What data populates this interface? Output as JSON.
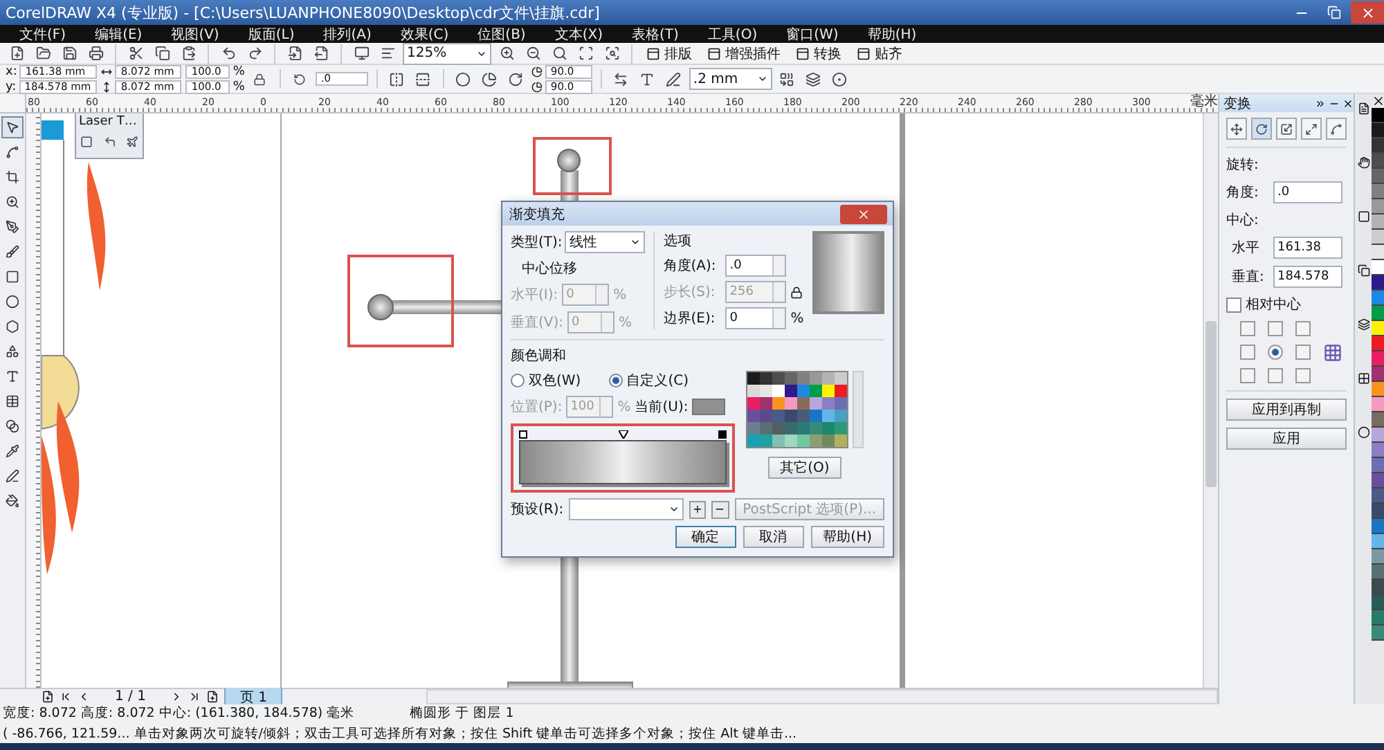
{
  "window": {
    "title": "CorelDRAW X4 (专业版) - [C:\\Users\\LUANPHONE8090\\Desktop\\cdr文件\\挂旗.cdr]"
  },
  "menu": [
    "文件(F)",
    "编辑(E)",
    "视图(V)",
    "版面(L)",
    "排列(A)",
    "效果(C)",
    "位图(B)",
    "文本(X)",
    "表格(T)",
    "工具(O)",
    "窗口(W)",
    "帮助(H)"
  ],
  "toolbar": {
    "zoom": "125%",
    "plugins": [
      "排版",
      "增强插件",
      "转换",
      "贴齐"
    ]
  },
  "property_bar": {
    "x": {
      "label": "x:",
      "value": "161.38 mm"
    },
    "y": {
      "label": "y:",
      "value": "184.578 mm"
    },
    "width": "8.072 mm",
    "height": "8.072 mm",
    "scale": [
      {
        "value": "100.0",
        "unit": "%"
      },
      {
        "value": "100.0",
        "unit": "%"
      }
    ],
    "rotation": ".0",
    "arc_angles": [
      "90.0",
      "90.0"
    ],
    "outline": ".2 mm"
  },
  "ruler": {
    "labels": [
      "80",
      "60",
      "40",
      "20",
      "0",
      "20",
      "40",
      "60",
      "80",
      "100",
      "120",
      "140",
      "160",
      "180",
      "200",
      "220",
      "240",
      "260",
      "280",
      "300"
    ],
    "unit": "毫米"
  },
  "toolbox": [
    {
      "selected": true
    },
    {
      "selected": false
    },
    {
      "selected": false
    },
    {
      "selected": false
    },
    {
      "selected": false
    },
    {
      "selected": false
    },
    {
      "selected": false
    },
    {
      "selected": false
    },
    {
      "selected": false
    },
    {
      "selected": false
    },
    {
      "selected": false
    },
    {
      "selected": false
    },
    {
      "selected": false
    },
    {
      "selected": false
    },
    {
      "selected": false
    },
    {
      "selected": false
    }
  ],
  "laser_toolbar": {
    "title": "Laser T…"
  },
  "dialog": {
    "title": "渐变填充",
    "type_label": "类型(T):",
    "type_value": "线性",
    "center_offset": "中心位移",
    "offsets": [
      {
        "label": "水平(I):",
        "value": "0",
        "unit": "%"
      },
      {
        "label": "垂直(V):",
        "value": "0",
        "unit": "%"
      }
    ],
    "options_title": "选项",
    "options": [
      {
        "label": "角度(A):",
        "value": ".0",
        "disabled": false
      },
      {
        "label": "步长(S):",
        "value": "256",
        "disabled": true
      },
      {
        "label": "边界(E):",
        "value": "0",
        "unit": "%",
        "disabled": false
      }
    ],
    "blend_title": "颜色调和",
    "radios": [
      {
        "label": "双色(W)",
        "selected": false
      },
      {
        "label": "自定义(C)",
        "selected": true
      }
    ],
    "position_label": "位置(P):",
    "position_value": "100",
    "position_unit": "%",
    "current_label": "当前(U):",
    "swatches": [
      {
        "color": "#1a1a1a"
      },
      {
        "color": "#333333"
      },
      {
        "color": "#4d4d4d"
      },
      {
        "color": "#666666"
      },
      {
        "color": "#808080"
      },
      {
        "color": "#999999"
      },
      {
        "color": "#b3b3b3"
      },
      {
        "color": "#cccccc"
      },
      {
        "color": "#d9d9d9"
      },
      {
        "color": "#e6e6e6"
      },
      {
        "color": "#ffffff"
      },
      {
        "color": "#2e1a8a"
      },
      {
        "color": "#1e88e5"
      },
      {
        "color": "#009e49"
      },
      {
        "color": "#fff200"
      },
      {
        "color": "#ed1c24"
      },
      {
        "color": "#e91e63"
      },
      {
        "color": "#a0306e"
      },
      {
        "color": "#f7941d"
      },
      {
        "color": "#f49ac1"
      },
      {
        "color": "#8c6a5a"
      },
      {
        "color": "#b7a6d9"
      },
      {
        "color": "#8a7fc4"
      },
      {
        "color": "#6a6fb5"
      },
      {
        "color": "#6b4f9e"
      },
      {
        "color": "#5a4a8a"
      },
      {
        "color": "#4a5a8a"
      },
      {
        "color": "#3a4a6a"
      },
      {
        "color": "#4a5a7a"
      },
      {
        "color": "#1a75c4"
      },
      {
        "color": "#62b6e8"
      },
      {
        "color": "#4aa0c0"
      },
      {
        "color": "#6a8090"
      },
      {
        "color": "#5a7070"
      },
      {
        "color": "#506060"
      },
      {
        "color": "#3a6a6a"
      },
      {
        "color": "#2a7a7a"
      },
      {
        "color": "#3a8a7a"
      },
      {
        "color": "#1a8a6a"
      },
      {
        "color": "#2a9a7a"
      },
      {
        "color": "#1aa0b0"
      },
      {
        "color": "#20a0a0"
      },
      {
        "color": "#80c0b0"
      },
      {
        "color": "#a0d8c0"
      },
      {
        "color": "#70c8a0"
      },
      {
        "color": "#8aa070"
      },
      {
        "color": "#708a60"
      },
      {
        "color": "#b0b060"
      }
    ],
    "other_button": "其它(O)",
    "preset_label": "预设(R):",
    "postscript_button": "PostScript 选项(P)...",
    "buttons": [
      "确定",
      "取消",
      "帮助(H)"
    ]
  },
  "docker": {
    "title": "变换",
    "tabs": [
      {
        "selected": false
      },
      {
        "selected": true
      },
      {
        "selected": false
      },
      {
        "selected": false
      },
      {
        "selected": false
      }
    ],
    "rotate_label": "旋转:",
    "angle_label": "角度:",
    "angle_value": ".0",
    "center_label": "中心:",
    "center_fields": [
      {
        "label": "水平",
        "value": "161.38"
      },
      {
        "label": "垂直:",
        "value": "184.578"
      }
    ],
    "relative_center": {
      "label": "相对中心",
      "checked": false
    },
    "anchors": [
      {
        "selected": false
      },
      {
        "selected": false
      },
      {
        "selected": false
      },
      {
        "selected": false
      },
      {
        "selected": true
      },
      {
        "selected": false
      },
      {
        "selected": false
      },
      {
        "selected": false
      },
      {
        "selected": false
      }
    ],
    "buttons": [
      "应用到再制",
      "应用"
    ]
  },
  "palette": [
    {
      "color": "#000000"
    },
    {
      "color": "#1a1a1a"
    },
    {
      "color": "#333333"
    },
    {
      "color": "#4d4d4d"
    },
    {
      "color": "#666666"
    },
    {
      "color": "#808080"
    },
    {
      "color": "#999999"
    },
    {
      "color": "#b3b3b3"
    },
    {
      "color": "#cccccc"
    },
    {
      "color": "#e6e6e6"
    },
    {
      "color": "#ffffff"
    },
    {
      "color": "#2e1a8a"
    },
    {
      "color": "#1e88e5"
    },
    {
      "color": "#009e49"
    },
    {
      "color": "#fff200"
    },
    {
      "color": "#ed1c24"
    },
    {
      "color": "#e91e63"
    },
    {
      "color": "#a0306e"
    },
    {
      "color": "#f7941d"
    },
    {
      "color": "#f49ac1"
    },
    {
      "color": "#7a6a60"
    },
    {
      "color": "#b7a6d9"
    },
    {
      "color": "#8a7fc4"
    },
    {
      "color": "#6a6fb5"
    },
    {
      "color": "#6b4f9e"
    },
    {
      "color": "#4a5a8a"
    },
    {
      "color": "#3a4a6a"
    },
    {
      "color": "#1a75c4"
    },
    {
      "color": "#62b6e8"
    },
    {
      "color": "#7a9aa8"
    },
    {
      "color": "#5a7070"
    },
    {
      "color": "#3a4a50"
    },
    {
      "color": "#2a5a5a"
    },
    {
      "color": "#2a7a6a"
    },
    {
      "color": "#3a8a7a"
    }
  ],
  "page_nav": {
    "counter": "1 / 1",
    "tab": "页 1"
  },
  "status": {
    "size": "宽度: 8.072  高度: 8.072  中心: (161.380, 184.578)  毫米",
    "object": "椭圆形 于 图层 1",
    "hint": "( -86.766, 121.59... 单击对象两次可旋转/倾斜；双击工具可选择所有对象；按住 Shift 键单击可选择多个对象；按住 Alt 键单击..."
  }
}
